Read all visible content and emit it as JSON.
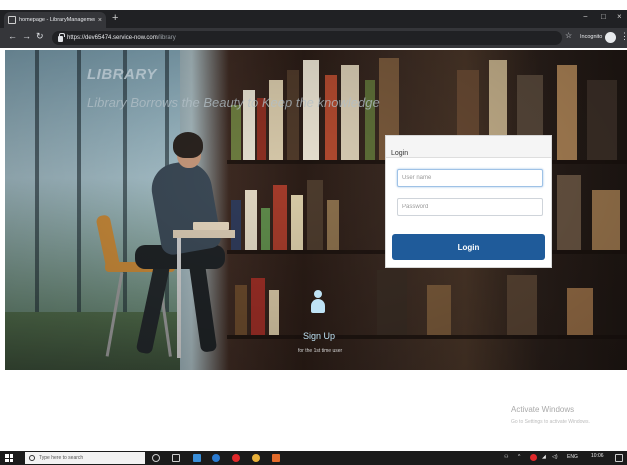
{
  "browser": {
    "tab_title": "homepage - LibraryManagement",
    "tab_close": "×",
    "new_tab": "+",
    "url_host": "https://dev65474.service-now.com",
    "url_path": "/library",
    "incognito_label": "Incognito",
    "window_controls": [
      "−",
      "□",
      "×"
    ]
  },
  "hero": {
    "title": "LIBRARY",
    "tagline": "Library Borrows the Beauty to Keep the knowledge"
  },
  "login": {
    "heading": "Login",
    "username_placeholder": "User name",
    "password_placeholder": "Password",
    "button_label": "Login"
  },
  "signup": {
    "link_label": "Sign Up",
    "note": "for the 1st time user"
  },
  "activation": {
    "title": "Activate Windows",
    "subtitle": "Go to Settings to activate Windows."
  },
  "taskbar": {
    "search_placeholder": "Type here to search",
    "language": "ENG",
    "time": "10:06"
  },
  "colors": {
    "login_button": "#1f5b9a",
    "signup_text": "#bfe3f5"
  }
}
